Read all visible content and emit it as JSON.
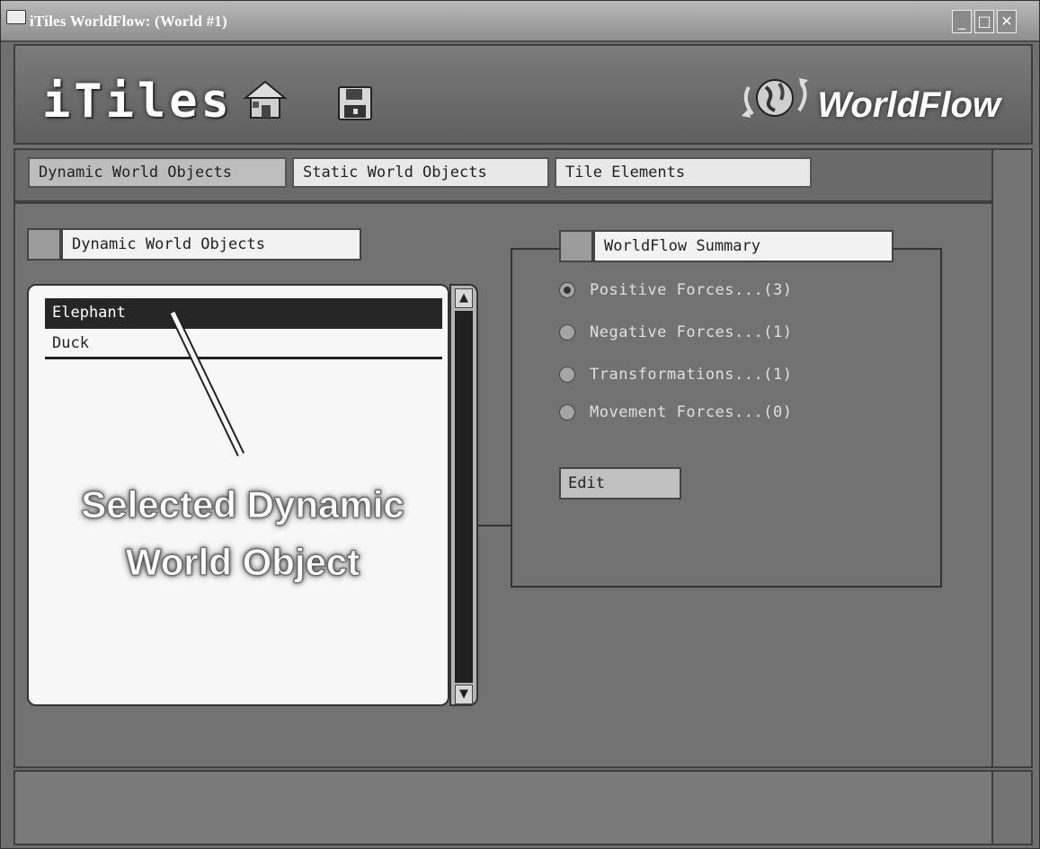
{
  "window": {
    "title": "iTiles WorldFlow: (World #1)",
    "controls": [
      "minimize",
      "maximize",
      "close"
    ]
  },
  "header": {
    "logo_text": "iTiles",
    "brand_text": "WorldFlow",
    "icons": [
      "home-icon",
      "save-icon",
      "globe-icon"
    ]
  },
  "tabs": [
    {
      "label": "Dynamic World Objects",
      "active": true
    },
    {
      "label": "Static World Objects",
      "active": false
    },
    {
      "label": "Tile Elements",
      "active": false
    }
  ],
  "objects_panel": {
    "title": "Dynamic World Objects",
    "items": [
      {
        "label": "Elephant",
        "selected": true
      },
      {
        "label": "Duck",
        "selected": false
      }
    ]
  },
  "annotation": {
    "line1": "Selected Dynamic",
    "line2": "World Object"
  },
  "summary_panel": {
    "title": "WorldFlow Summary",
    "options": [
      {
        "label": "Positive Forces...(3)",
        "checked": true
      },
      {
        "label": "Negative Forces...(1)",
        "checked": false
      },
      {
        "label": "Transformations...(1)",
        "checked": false
      },
      {
        "label": "Movement Forces...(0)",
        "checked": false
      }
    ],
    "edit_label": "Edit"
  }
}
